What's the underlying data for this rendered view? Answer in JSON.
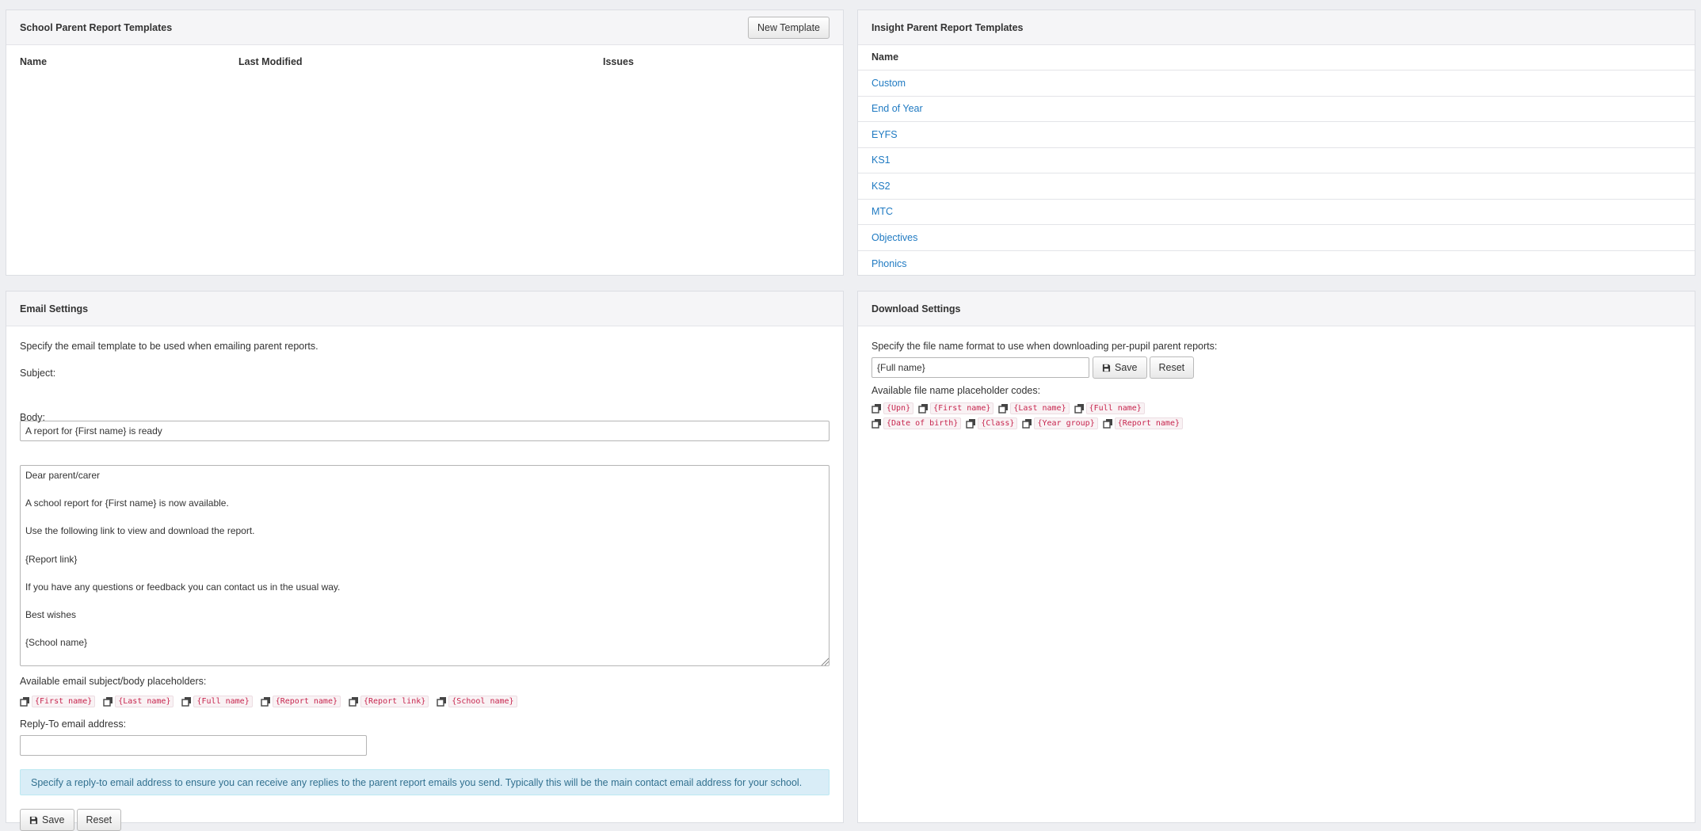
{
  "school_templates": {
    "title": "School Parent Report Templates",
    "new_button": "New Template",
    "columns": [
      "Name",
      "Last Modified",
      "Issues"
    ]
  },
  "insight_templates": {
    "title": "Insight Parent Report Templates",
    "column": "Name",
    "items": [
      "Custom",
      "End of Year",
      "EYFS",
      "KS1",
      "KS2",
      "MTC",
      "Objectives",
      "Phonics"
    ]
  },
  "email_settings": {
    "title": "Email Settings",
    "intro": "Specify the email template to be used when emailing parent reports.",
    "subject_label": "Subject:",
    "subject_value": "A report for {First name} is ready",
    "body_label": "Body:",
    "body_value": "Dear parent/carer\n\nA school report for {First name} is now available.\n\nUse the following link to view and download the report.\n\n{Report link}\n\nIf you have any questions or feedback you can contact us in the usual way.\n\nBest wishes\n\n{School name}",
    "placeholders_label": "Available email subject/body placeholders:",
    "placeholders": [
      "{First name}",
      "{Last name}",
      "{Full name}",
      "{Report name}",
      "{Report link}",
      "{School name}"
    ],
    "reply_to_label": "Reply-To email address:",
    "reply_to_value": "",
    "info": "Specify a reply-to email address to ensure you can receive any replies to the parent report emails you send. Typically this will be the main contact email address for your school.",
    "save_label": "Save",
    "reset_label": "Reset"
  },
  "download_settings": {
    "title": "Download Settings",
    "intro": "Specify the file name format to use when downloading per-pupil parent reports:",
    "filename_value": "{Full name}",
    "save_label": "Save",
    "reset_label": "Reset",
    "codes_label": "Available file name placeholder codes:",
    "codes_row1": [
      "{Upn}",
      "{First name}",
      "{Last name}",
      "{Full name}"
    ],
    "codes_row2": [
      "{Date of birth}",
      "{Class}",
      "{Year group}",
      "{Report name}"
    ]
  },
  "colors": {
    "link": "#1f7ac2",
    "code_text": "#c7254e",
    "info_bg": "#d9edf7",
    "info_text": "#31708f"
  },
  "icons": {
    "copy": "copy-icon",
    "save": "floppy-disk-icon",
    "resize": "resize-grip-icon"
  }
}
